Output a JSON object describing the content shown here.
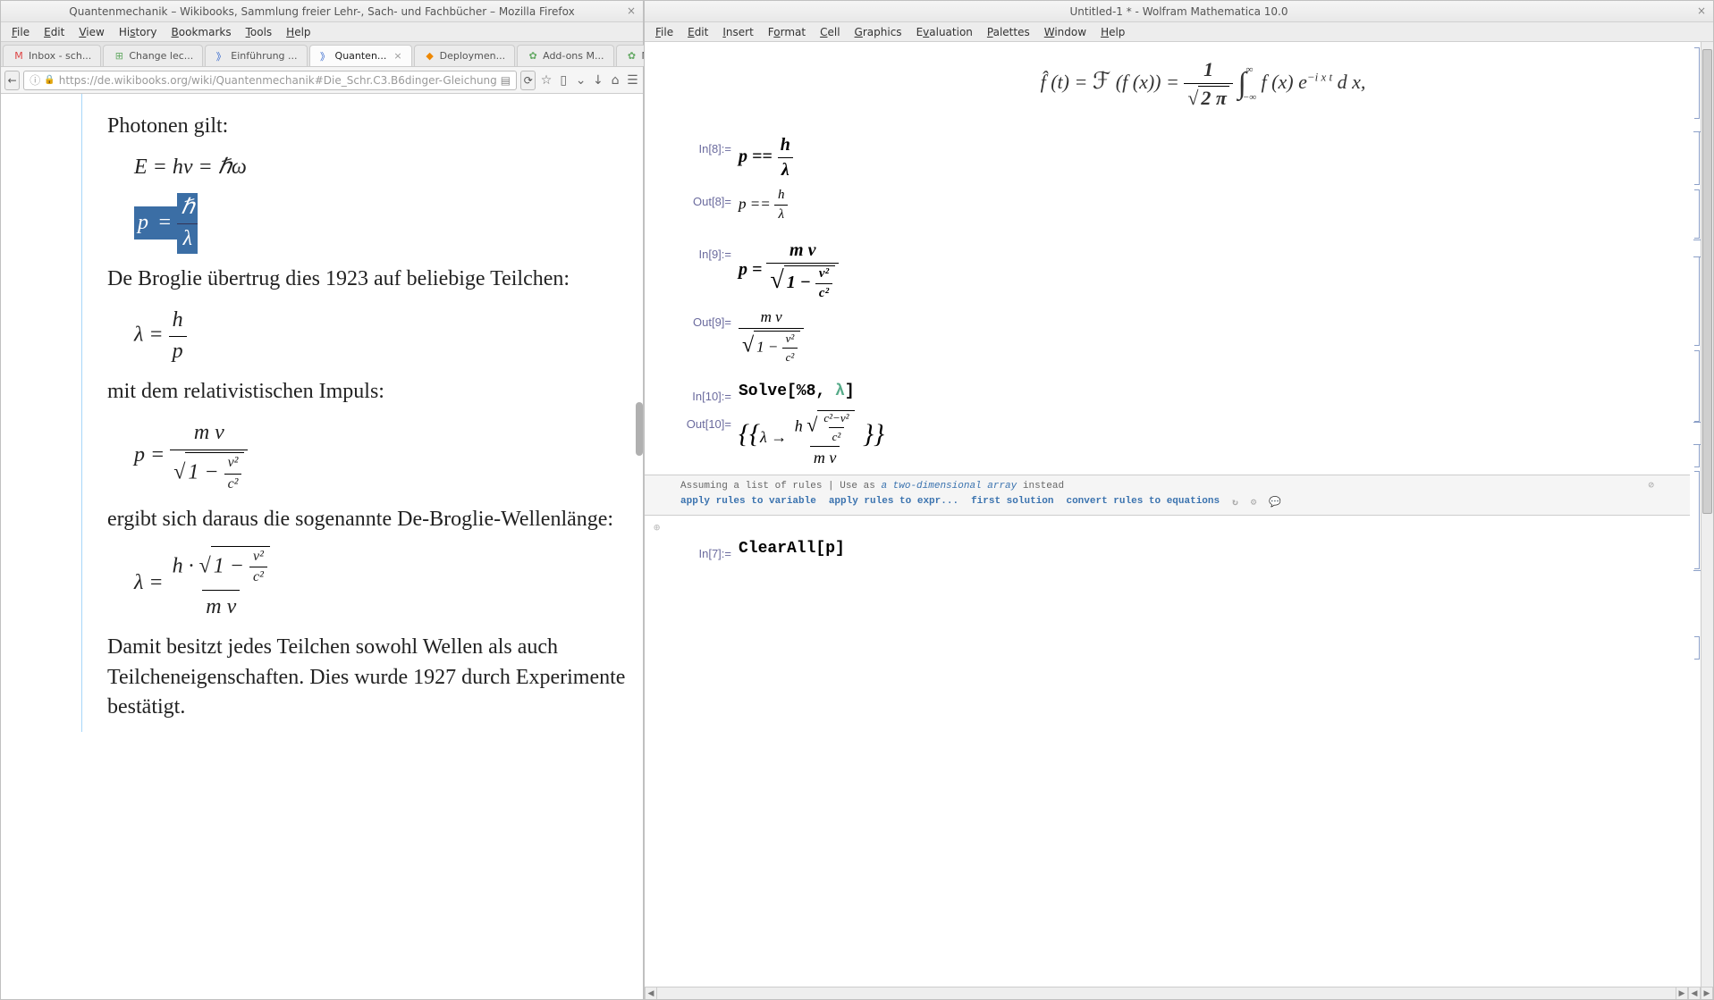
{
  "firefox": {
    "title": "Quantenmechanik – Wikibooks, Sammlung freier Lehr-, Sach- und Fachbücher – Mozilla Firefox",
    "menu": [
      "File",
      "Edit",
      "View",
      "History",
      "Bookmarks",
      "Tools",
      "Help"
    ],
    "tabs": [
      {
        "label": "Inbox - sch..."
      },
      {
        "label": "Change lec..."
      },
      {
        "label": "Einführung ..."
      },
      {
        "label": "Quanten...",
        "active": true,
        "closeable": true
      },
      {
        "label": "Deploymen..."
      },
      {
        "label": "Add-ons M..."
      },
      {
        "label": "Mathzilla :: ..."
      }
    ],
    "url": "https://de.wikibooks.org/wiki/Quantenmechanik#Die_Schr.C3.B6dinger-Gleichung",
    "page": {
      "l0": "Photonen gilt:",
      "eq1": "E = hν = ℏω",
      "l1": "De Broglie übertrug dies 1923 auf beliebige Teilchen:",
      "l2": "mit dem relativistischen Impuls:",
      "l3": "ergibt sich daraus die sogenannte De-Broglie-Wellenlänge:",
      "l4": "Damit besitzt jedes Teilchen sowohl Wellen als auch Teilcheneigenschaften. Dies wurde 1927 durch Experimente bestätigt."
    }
  },
  "mathematica": {
    "title": "Untitled-1 * - Wolfram Mathematica 10.0",
    "menu": [
      "File",
      "Edit",
      "Insert",
      "Format",
      "Cell",
      "Graphics",
      "Evaluation",
      "Palettes",
      "Window",
      "Help"
    ],
    "fourier": "f̂ (t) = ℱ (f (x)) = (1 / √(2π)) ∫_{-∞}^{∞} f(x) e^{-i x t} d x,",
    "cells": [
      {
        "in": "In[8]:=",
        "expr": "p == h / λ"
      },
      {
        "out": "Out[8]=",
        "expr": "p == h / λ"
      },
      {
        "in": "In[9]:=",
        "expr": "p = m v / √(1 - v²/c²)"
      },
      {
        "out": "Out[9]=",
        "expr": "m v / √(1 - v²/c²)"
      },
      {
        "in": "In[10]:=",
        "expr": "Solve[%8, λ]"
      },
      {
        "out": "Out[10]=",
        "expr": "{{λ → h √((c²-v²)/c²) / (m v)}}"
      },
      {
        "in": "In[7]:=",
        "expr": "ClearAll[p]"
      }
    ],
    "suggestions": {
      "assume": "Assuming a list of rules | Use as ",
      "alt": "a two-dimensional array",
      "instead": " instead",
      "opts": [
        "apply rules to variable",
        "apply rules to expr...",
        "first solution",
        "convert rules to equations"
      ]
    }
  }
}
